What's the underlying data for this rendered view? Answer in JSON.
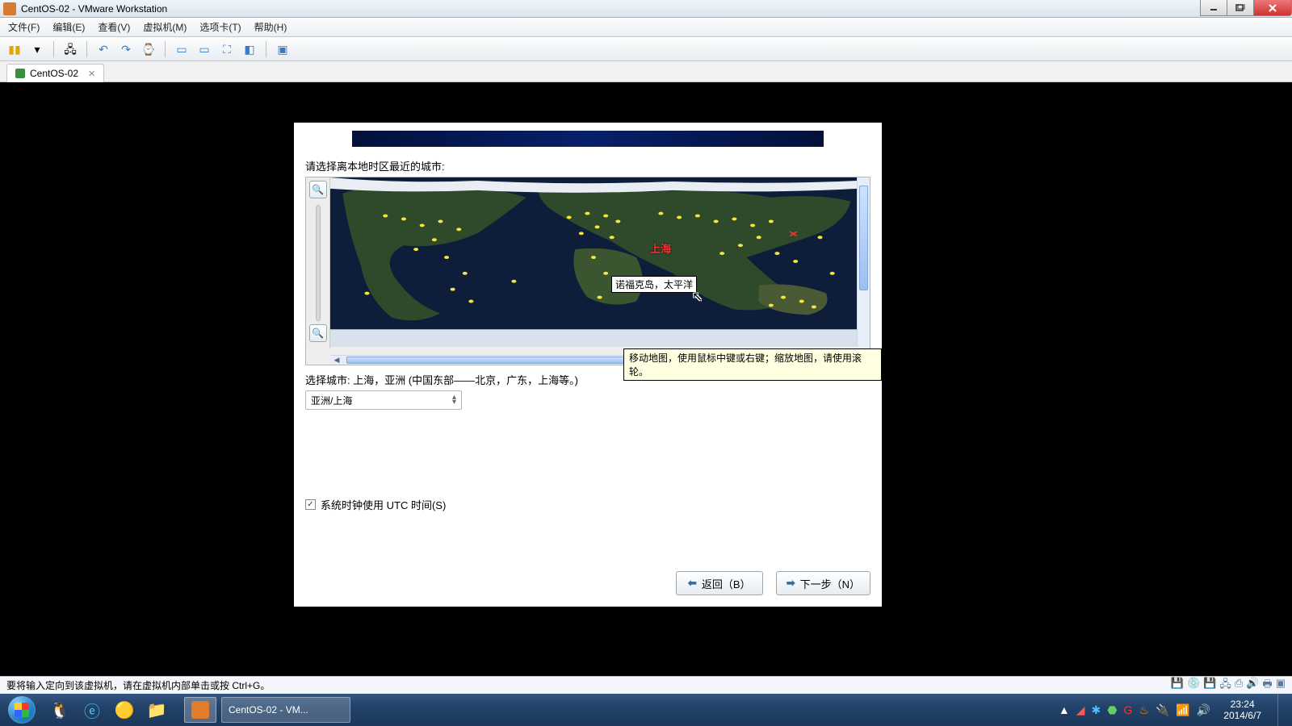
{
  "window": {
    "title": "CentOS-02 - VMware Workstation"
  },
  "menu": {
    "file": "文件(F)",
    "edit": "编辑(E)",
    "view": "查看(V)",
    "vm": "虚拟机(M)",
    "tabs": "选项卡(T)",
    "help": "帮助(H)"
  },
  "tab": {
    "label": "CentOS-02"
  },
  "installer": {
    "prompt": "请选择离本地时区最近的城市:",
    "selected_marker": "上海",
    "tooltip": "诺福克岛，太平洋",
    "hint": "移动地图，使用鼠标中键或右键；缩放地图，请使用滚轮。",
    "city_desc": "选择城市: 上海，亚洲 (中国东部——北京，广东，上海等。)",
    "tz_value": "亚洲/上海",
    "utc_label": "系统时钟使用 UTC 时间(S)",
    "utc_checked": true,
    "back": "返回（B）",
    "next": "下一步（N）"
  },
  "vm_status": {
    "text": "要将输入定向到该虚拟机，请在虚拟机内部单击或按 Ctrl+G。"
  },
  "taskbar": {
    "active_item": "CentOS-02 - VM..."
  },
  "clock": {
    "time": "23:24",
    "date": "2014/6/7"
  }
}
